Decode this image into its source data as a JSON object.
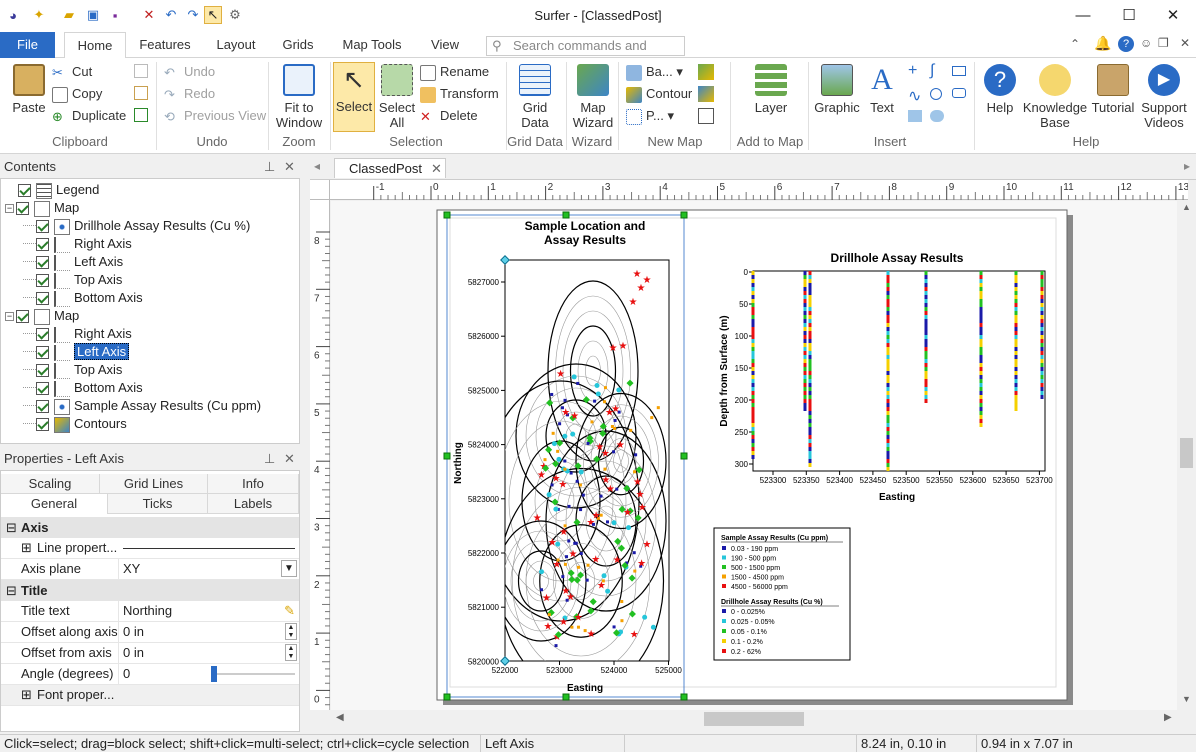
{
  "app": {
    "title": "Surfer - [ClassedPost]"
  },
  "ribbon_tabs": [
    "File",
    "Home",
    "Features",
    "Layout",
    "Grids",
    "Map Tools",
    "View"
  ],
  "search": {
    "placeholder": "Search commands and Help..."
  },
  "ribbon": {
    "clipboard": {
      "paste": "Paste",
      "cut": "Cut",
      "copy": "Copy",
      "duplicate": "Duplicate",
      "label": "Clipboard"
    },
    "undo": {
      "undo": "Undo",
      "redo": "Redo",
      "previous_view": "Previous View",
      "label": "Undo"
    },
    "zoom": {
      "fit": "Fit to Window",
      "label": "Zoom"
    },
    "selection": {
      "select": "Select",
      "select_all": "Select All",
      "rename": "Rename",
      "transform": "Transform",
      "delete": "Delete",
      "label": "Selection"
    },
    "grid_data": {
      "btn": "Grid Data",
      "label": "Grid Data"
    },
    "wizard": {
      "btn": "Map Wizard",
      "label": "Wizard"
    },
    "new_map": {
      "base": "Ba...",
      "contour": "Contour",
      "post": "P...",
      "label": "New Map"
    },
    "add_to_map": {
      "layer": "Layer",
      "label": "Add to Map"
    },
    "insert": {
      "graphic": "Graphic",
      "text": "Text",
      "label": "Insert"
    },
    "help": {
      "help": "Help",
      "kb": "Knowledge Base",
      "tutorial": "Tutorial",
      "videos": "Support Videos",
      "label": "Help"
    }
  },
  "contents": {
    "title": "Contents",
    "items": [
      {
        "label": "Legend",
        "level": 0,
        "checked": true
      },
      {
        "label": "Map",
        "level": 0,
        "checked": true
      },
      {
        "label": "Drillhole Assay Results (Cu %)",
        "level": 1,
        "checked": true
      },
      {
        "label": "Right Axis",
        "level": 1,
        "checked": true
      },
      {
        "label": "Left Axis",
        "level": 1,
        "checked": true
      },
      {
        "label": "Top Axis",
        "level": 1,
        "checked": true
      },
      {
        "label": "Bottom Axis",
        "level": 1,
        "checked": true
      },
      {
        "label": "Map",
        "level": 0,
        "checked": true
      },
      {
        "label": "Right Axis",
        "level": 1,
        "checked": true
      },
      {
        "label": "Left Axis",
        "level": 1,
        "checked": true,
        "selected": true
      },
      {
        "label": "Top Axis",
        "level": 1,
        "checked": true
      },
      {
        "label": "Bottom Axis",
        "level": 1,
        "checked": true
      },
      {
        "label": "Sample Assay Results (Cu ppm)",
        "level": 1,
        "checked": true
      },
      {
        "label": "Contours",
        "level": 1,
        "checked": true
      }
    ]
  },
  "properties": {
    "title": "Properties - Left Axis",
    "tabs_row1": [
      "Scaling",
      "Grid Lines",
      "Info"
    ],
    "tabs_row2": [
      "General",
      "Ticks",
      "Labels"
    ],
    "section_axis": "Axis",
    "line_properties": "Line propert...",
    "axis_plane_label": "Axis plane",
    "axis_plane_value": "XY",
    "section_title": "Title",
    "title_text_label": "Title text",
    "title_text_value": "Northing",
    "offset_along_label": "Offset along axis",
    "offset_along_value": "0 in",
    "offset_from_label": "Offset from axis",
    "offset_from_value": "0 in",
    "angle_label": "Angle (degrees)",
    "angle_value": "0",
    "font_properties": "Font proper..."
  },
  "document": {
    "tab": "ClassedPost",
    "ruler_top": [
      "-1",
      "0",
      "1",
      "2",
      "3",
      "4",
      "5",
      "6",
      "7",
      "8",
      "9",
      "10",
      "11",
      "12",
      "13"
    ],
    "ruler_left": [
      "8",
      "7",
      "6",
      "5",
      "4",
      "3",
      "2",
      "1",
      "0"
    ]
  },
  "map1": {
    "title_line1": "Sample Location and",
    "title_line2": "Assay Results",
    "ylabel": "Northing",
    "xlabel": "Easting",
    "yticks": [
      "5827000",
      "5826000",
      "5825000",
      "5824000",
      "5823000",
      "5822000",
      "5821000",
      "5820000"
    ],
    "xticks": [
      "522000",
      "523000",
      "524000",
      "525000"
    ]
  },
  "map2": {
    "title": "Drillhole Assay Results",
    "ylabel": "Depth from Surface (m)",
    "xlabel": "Easting",
    "yticks": [
      "0",
      "50",
      "100",
      "150",
      "200",
      "250",
      "300"
    ],
    "xticks": [
      "523300",
      "523350",
      "523400",
      "523450",
      "523500",
      "523550",
      "523600",
      "523650",
      "523700"
    ]
  },
  "legend": {
    "title1": "Sample Assay Results (Cu ppm)",
    "items1": [
      {
        "label": "0.03 - 190 ppm",
        "color": "#1a1aa8"
      },
      {
        "label": "190 - 500 ppm",
        "color": "#26c6da"
      },
      {
        "label": "500 - 1500 ppm",
        "color": "#22c022"
      },
      {
        "label": "1500 - 4500 ppm",
        "color": "#f5a000"
      },
      {
        "label": "4500 - 56000 ppm",
        "color": "#e81010"
      }
    ],
    "title2": "Drillhole Assay Results (Cu %)",
    "items2": [
      {
        "label": "0 - 0.025%",
        "color": "#1a1aa8"
      },
      {
        "label": "0.025 - 0.05%",
        "color": "#26c6da"
      },
      {
        "label": "0.05 - 0.1%",
        "color": "#22c022"
      },
      {
        "label": "0.1 - 0.2%",
        "color": "#f5d000"
      },
      {
        "label": "0.2 - 62%",
        "color": "#e81010"
      }
    ]
  },
  "status": {
    "hint": "Click=select; drag=block select; shift+click=multi-select; ctrl+click=cycle selection",
    "selection": "Left Axis",
    "position": "8.24 in, 0.10 in",
    "size": "0.94 in x 7.07 in"
  }
}
